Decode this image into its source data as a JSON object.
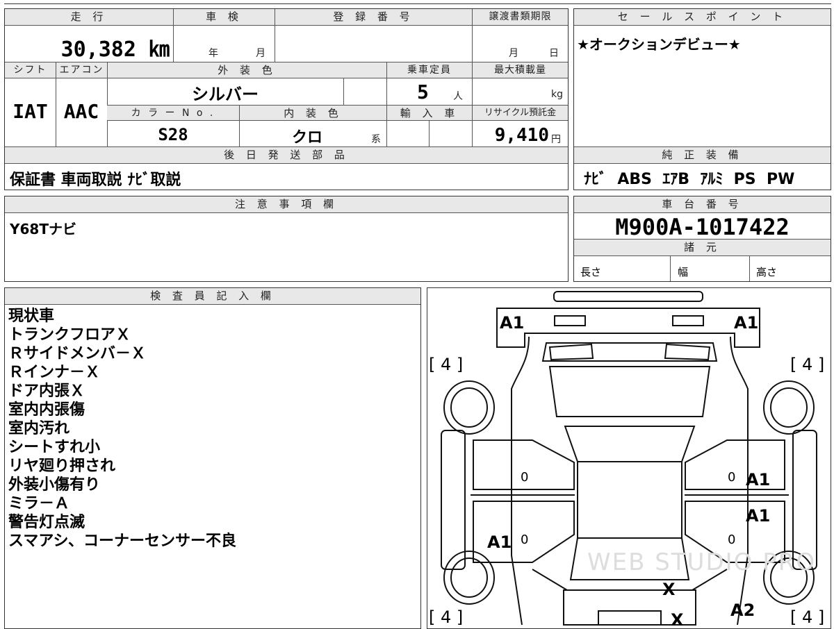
{
  "top_table": {
    "mileage_header": "走 行",
    "mileage": "30,382 ㎞",
    "shaken_header": "車 検",
    "shaken_year": "年",
    "shaken_month": "月",
    "registration_header": "登 録 番 号",
    "transfer_header": "譲渡書類期限",
    "transfer_month": "月",
    "transfer_day": "日",
    "shift_header": "シフト",
    "shift": "IAT",
    "ac_header": "エアコン",
    "ac": "AAC",
    "exterior_header": "外 装 色",
    "exterior_color": "シルバー",
    "capacity_header": "乗車定員",
    "capacity": "5",
    "capacity_unit": "人",
    "max_load_header": "最大積載量",
    "max_load_unit": "kg",
    "color_no_header": "カ ラ ー N o .",
    "color_no": "S28",
    "interior_header": "内 装 色",
    "interior_color": "クロ",
    "interior_suffix": "系",
    "import_header": "輸 入 車",
    "recycle_header": "リサイクル預託金",
    "recycle_fee": "9,410",
    "recycle_unit": "円"
  },
  "sales_point": {
    "header": "セ ー ル ス ポ イ ン ト",
    "text": "★オークションデビュー★"
  },
  "parts": {
    "header": "後 日 発 送 部 品",
    "text": "保証書 車両取説 ﾅﾋﾞ取説"
  },
  "equipment": {
    "header": "純 正 装 備",
    "text": "ﾅﾋﾞ  ABS  ｴｱB  ｱﾙﾐ  PS  PW"
  },
  "notes": {
    "header": "注 意 事 項 欄",
    "text": "Y68Tナビ"
  },
  "chassis": {
    "header": "車 台 番 号",
    "number": "M900A-1017422",
    "specs_header": "諸 元",
    "length": "長さ",
    "width": "幅",
    "height": "高さ"
  },
  "inspector": {
    "header": "検 査 員 記 入 欄",
    "lines": [
      "現状車",
      "トランクフロアＸ",
      "Ｒサイドメンバ－Ｘ",
      "Ｒインナ－Ｘ",
      "ドア内張Ｘ",
      "室内内張傷",
      "室内汚れ",
      "シートすれ小",
      "リヤ廻り押され",
      "外装小傷有り",
      "ミラ－Ａ",
      "警告灯点滅",
      "スマアシ、コーナーセンサー不良"
    ]
  },
  "diagram": {
    "tire_bracket": "[ 4 ]",
    "mark_a1": "A1",
    "mark_a2": "A2",
    "mark_x": "X",
    "mark_zero": "0",
    "watermark": "WEB STUDIO PRO"
  }
}
